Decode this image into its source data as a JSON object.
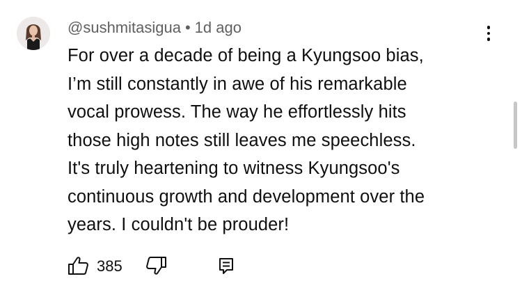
{
  "comment": {
    "author": "@sushmitasigua",
    "separator": "•",
    "timestamp": "1d ago",
    "body_lines": [
      "For over a decade of being a Kyungsoo bias,",
      "I’m still constantly in awe of his remarkable",
      "vocal prowess. The way he effortlessly hits",
      "those high notes still leaves me speechless.",
      "It's truly heartening to witness Kyungsoo's",
      "continuous growth and development over the",
      "years. I couldn't be prouder!"
    ],
    "like_count": "385"
  },
  "icons": {
    "avatar": "avatar",
    "more": "more-vert-icon",
    "like": "thumbs-up-icon",
    "dislike": "thumbs-down-icon",
    "reply": "reply-icon"
  },
  "colors": {
    "text": "#0f0f0f",
    "meta": "#606060",
    "scrollbar": "#c7c7c7"
  }
}
